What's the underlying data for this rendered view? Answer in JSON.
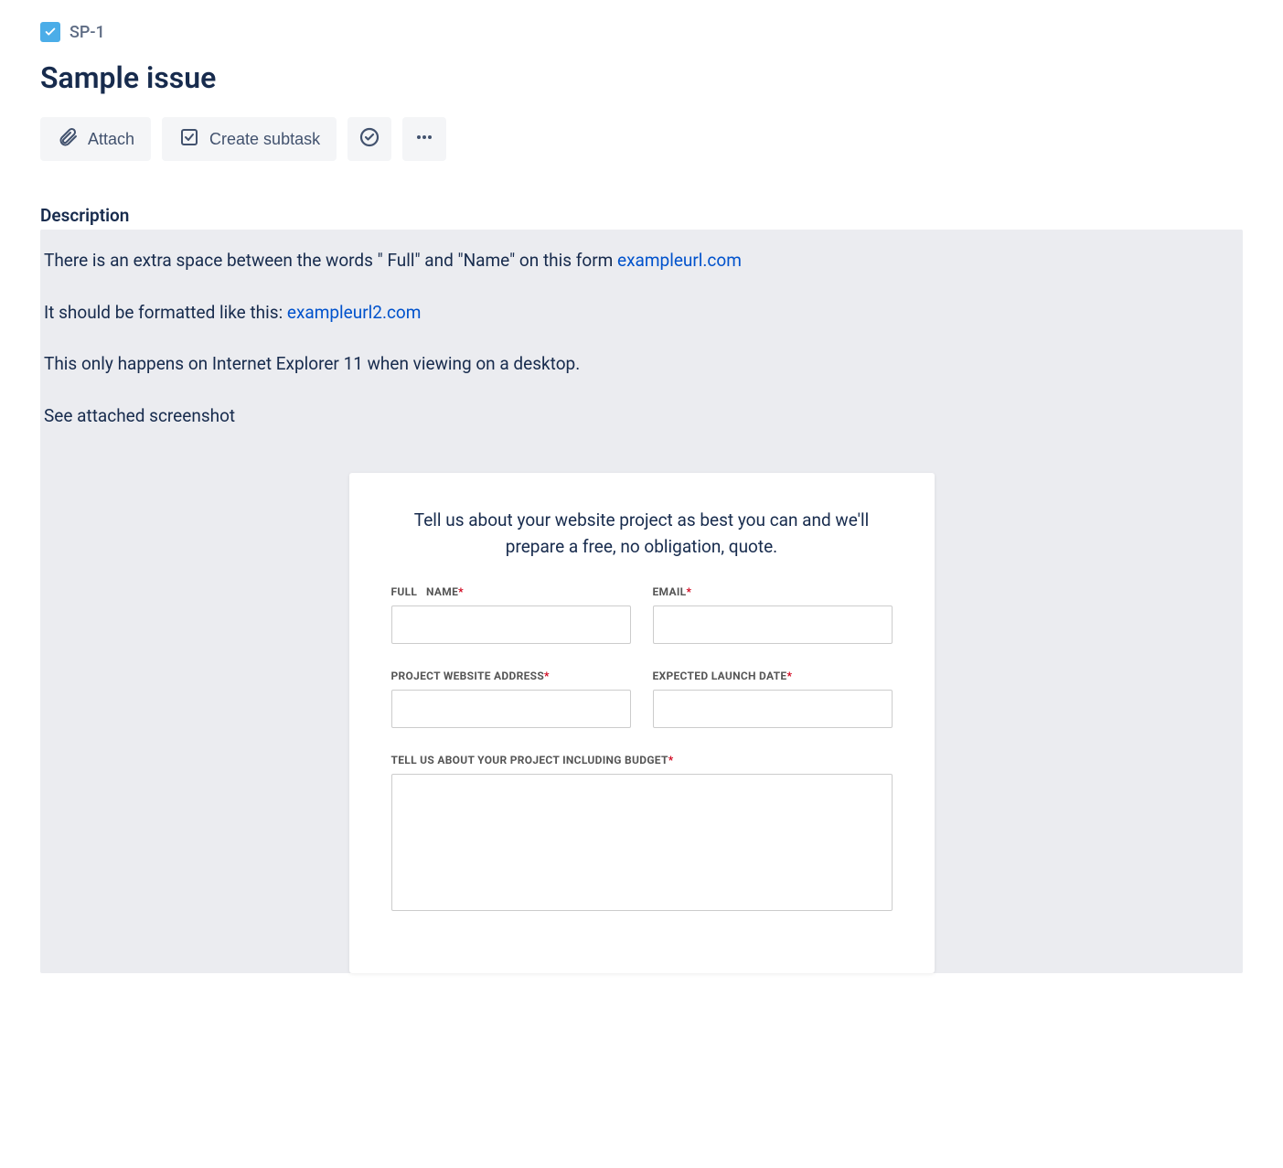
{
  "breadcrumb": {
    "issue_key": "SP-1"
  },
  "title": "Sample issue",
  "toolbar": {
    "attach_label": "Attach",
    "subtask_label": "Create subtask"
  },
  "section": {
    "description_heading": "Description"
  },
  "description": {
    "p1_prefix": "There is an extra space between the words \" Full\" and \"Name\" on this form ",
    "p1_link": "exampleurl.com",
    "p2_prefix": "It should be formatted like this: ",
    "p2_link": "exampleurl2.com",
    "p3": "This only happens on Internet Explorer 11 when viewing on a desktop.",
    "p4": "See attached screenshot"
  },
  "attachment_form": {
    "intro": "Tell us about your website project as best you can and we'll prepare a free, no obligation, quote.",
    "full_name_label": "FULL   NAME",
    "email_label": "EMAIL",
    "project_website_label": "PROJECT WEBSITE ADDRESS",
    "launch_date_label": "EXPECTED LAUNCH DATE",
    "tell_us_label": "TELL US ABOUT YOUR PROJECT INCLUDING BUDGET",
    "required_mark": "*"
  }
}
